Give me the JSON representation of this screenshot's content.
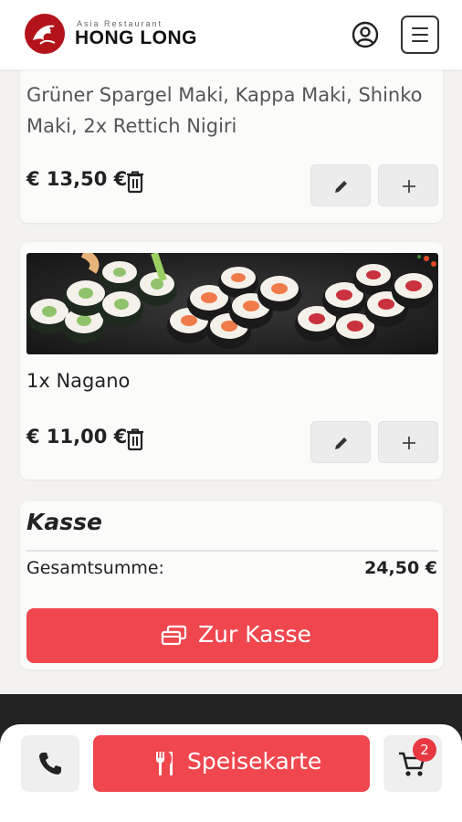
{
  "header": {
    "logo_sub": "Asia Restaurant",
    "logo_name": "HONG LONG"
  },
  "cart_items": [
    {
      "description": "Grüner Spargel Maki, Kappa Maki, Shinko Maki, 2x Rettich Nigiri",
      "price": "€ 13,50 €"
    },
    {
      "name": "1x Nagano",
      "price": "€ 11,00 €"
    }
  ],
  "kasse": {
    "title": "Kasse",
    "total_label": "Gesamtsumme:",
    "total_value": "24,50 €",
    "checkout_label": "Zur Kasse"
  },
  "bottom_bar": {
    "menu_label": "Speisekarte",
    "cart_count": "2"
  },
  "colors": {
    "accent": "#f0474f",
    "badge": "#e83841",
    "footer": "#232323"
  },
  "icons": [
    "dragon-logo-icon",
    "account-icon",
    "hamburger-icon",
    "trash-icon",
    "pencil-icon",
    "plus-icon",
    "checkout-icon",
    "phone-icon",
    "fork-knife-icon",
    "cart-icon"
  ]
}
